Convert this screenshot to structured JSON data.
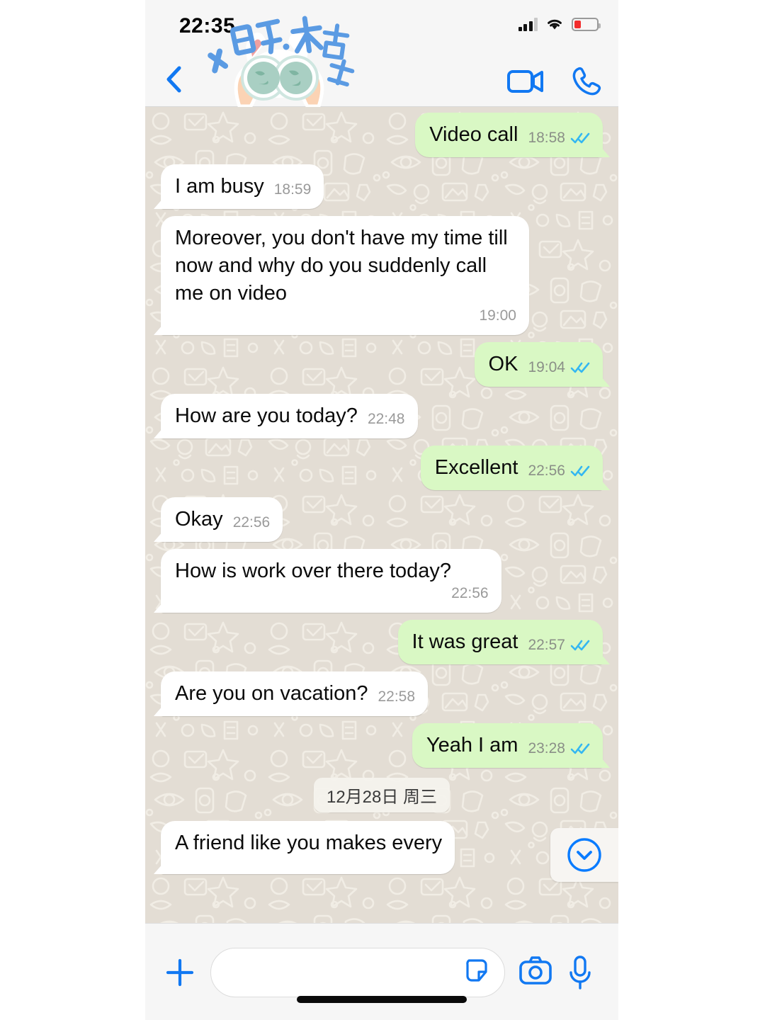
{
  "status_bar": {
    "time": "22:35",
    "signal_icon": "cellular-signal-icon",
    "wifi_icon": "wifi-icon",
    "battery_icon": "battery-low-icon",
    "battery_level_pct": 20
  },
  "header": {
    "back_icon": "back-chevron-icon",
    "video_call_icon": "video-call-icon",
    "voice_call_icon": "phone-call-icon",
    "sticker": {
      "name": "globe-binoculars-sticker",
      "text": "小日子，大盛放",
      "text_color": "#4a90e2",
      "globe_color": "#8fc6b4",
      "hand_color": "#f8cdae"
    }
  },
  "chat": {
    "background_color": "#e3ddd4",
    "outgoing_bubble_color": "#d9f8c4",
    "incoming_bubble_color": "#ffffff",
    "tick_color": "#34b7f1",
    "messages": [
      {
        "id": "m1",
        "dir": "out",
        "text": "Video call",
        "time": "18:58",
        "status": "read"
      },
      {
        "id": "m2",
        "dir": "in",
        "text": "I am busy",
        "time": "18:59",
        "status": ""
      },
      {
        "id": "m3",
        "dir": "in",
        "text": "Moreover, you don't have my time till now and why do you suddenly call me on video",
        "time": "19:00",
        "status": "",
        "wrap": true
      },
      {
        "id": "m4",
        "dir": "out",
        "text": "OK",
        "time": "19:04",
        "status": "read"
      },
      {
        "id": "m5",
        "dir": "in",
        "text": "How are you today?",
        "time": "22:48",
        "status": ""
      },
      {
        "id": "m6",
        "dir": "out",
        "text": "Excellent",
        "time": "22:56",
        "status": "read"
      },
      {
        "id": "m7",
        "dir": "in",
        "text": "Okay",
        "time": "22:56",
        "status": ""
      },
      {
        "id": "m8",
        "dir": "in",
        "text": "How is work over there today?",
        "time": "22:56",
        "status": "",
        "wrap": true
      },
      {
        "id": "m9",
        "dir": "out",
        "text": "It was great",
        "time": "22:57",
        "status": "read"
      },
      {
        "id": "m10",
        "dir": "in",
        "text": "Are you on vacation?",
        "time": "22:58",
        "status": ""
      },
      {
        "id": "m11",
        "dir": "out",
        "text": "Yeah I am",
        "time": "23:28",
        "status": "read"
      }
    ],
    "date_divider": "12月28日 周三",
    "partial_message": {
      "id": "m12",
      "dir": "in",
      "text": "A friend like you makes every"
    },
    "scroll_button_icon": "chevron-down-circle-icon"
  },
  "input_bar": {
    "plus_icon": "plus-icon",
    "input_value": "",
    "input_placeholder": "",
    "sticker_icon": "sticker-icon",
    "camera_icon": "camera-icon",
    "mic_icon": "microphone-icon"
  }
}
